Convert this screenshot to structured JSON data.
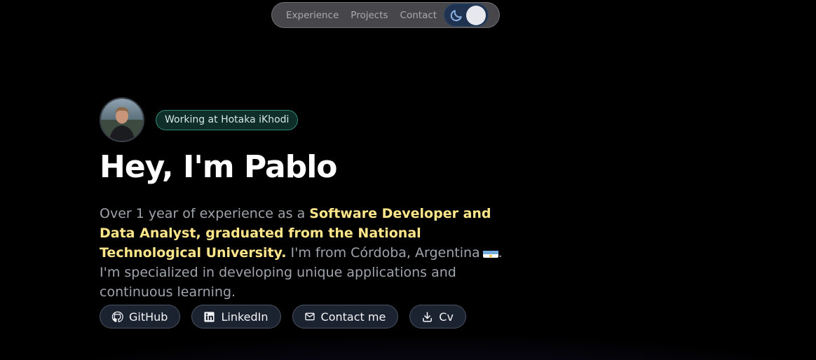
{
  "nav": {
    "links": [
      "Experience",
      "Projects",
      "Contact"
    ],
    "theme_toggle": {
      "icon": "moon-icon",
      "state": "dark"
    }
  },
  "hero": {
    "avatar_icon": "avatar-photo",
    "badge": "Working at Hotaka iKhodi",
    "headline": "Hey, I'm Pablo",
    "bio": {
      "prefix": "Over 1 year of experience as a ",
      "highlight": "Software Developer and Data Analyst, graduated from the National Technological University.",
      "location": " I'm from Córdoba, Argentina",
      "suffix": ". I'm specialized in developing unique applications and continuous learning."
    },
    "actions": [
      {
        "label": "GitHub",
        "icon": "github-icon"
      },
      {
        "label": "LinkedIn",
        "icon": "linkedin-icon"
      },
      {
        "label": "Contact me",
        "icon": "mail-icon"
      },
      {
        "label": "Cv",
        "icon": "download-icon"
      }
    ]
  },
  "colors": {
    "background": "#000000",
    "highlight": "#fde68a",
    "badge_border": "#2f8a76",
    "text_muted": "#9ea3ac"
  }
}
